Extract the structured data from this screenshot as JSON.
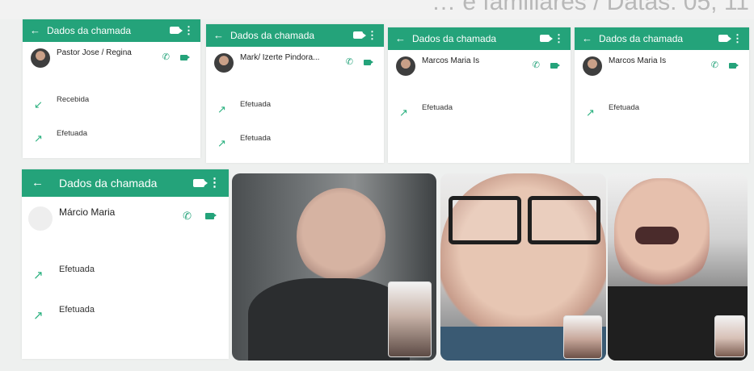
{
  "header_text": "… e familiares / Datas: 05, 11",
  "panels": [
    {
      "id": "p1",
      "bar_title": "Dados da chamada",
      "contact_name": "Pastor Jose / Regina",
      "contact_sub": "",
      "date": "",
      "rows": [
        {
          "type": "Recebida",
          "time": "",
          "duration": "",
          "size": "",
          "direction": "in"
        },
        {
          "type": "Efetuada",
          "time": "",
          "duration": "",
          "size": "",
          "direction": "out"
        }
      ]
    },
    {
      "id": "p2",
      "bar_title": "Dados da chamada",
      "contact_name": "Mark/ Izerte Pindora...",
      "contact_sub": "",
      "date": "",
      "rows": [
        {
          "type": "Efetuada",
          "time": "",
          "duration": "",
          "size": "",
          "direction": "out"
        },
        {
          "type": "Efetuada",
          "time": "",
          "duration": "",
          "size": "",
          "direction": "out"
        }
      ]
    },
    {
      "id": "p3",
      "bar_title": "Dados da chamada",
      "contact_name": "Marcos Maria Is",
      "contact_sub": "",
      "date": "",
      "rows": [
        {
          "type": "Efetuada",
          "time": "",
          "duration": "",
          "size": "",
          "direction": "out"
        }
      ]
    },
    {
      "id": "p4",
      "bar_title": "Dados da chamada",
      "contact_name": "Marcos Maria Is",
      "contact_sub": "",
      "date": "",
      "rows": [
        {
          "type": "Efetuada",
          "time": "",
          "duration": "",
          "size": "",
          "direction": "out"
        }
      ]
    },
    {
      "id": "p5",
      "bar_title": "Dados da chamada",
      "contact_name": "Márcio Maria",
      "contact_sub": "",
      "date": "",
      "rows": [
        {
          "type": "Efetuada",
          "time": "",
          "duration": "",
          "size": "",
          "direction": "out"
        },
        {
          "type": "Efetuada",
          "time": "",
          "duration": "",
          "size": "",
          "direction": "out"
        }
      ]
    }
  ],
  "icons": {
    "back": "arrow-left-icon",
    "video": "video-camera-icon",
    "more": "more-vertical-icon",
    "call": "phone-icon",
    "outgoing": "outgoing-call-arrow-icon",
    "incoming": "incoming-call-arrow-icon"
  },
  "colors": {
    "accent": "#24a37a",
    "background": "#eef0ef"
  }
}
